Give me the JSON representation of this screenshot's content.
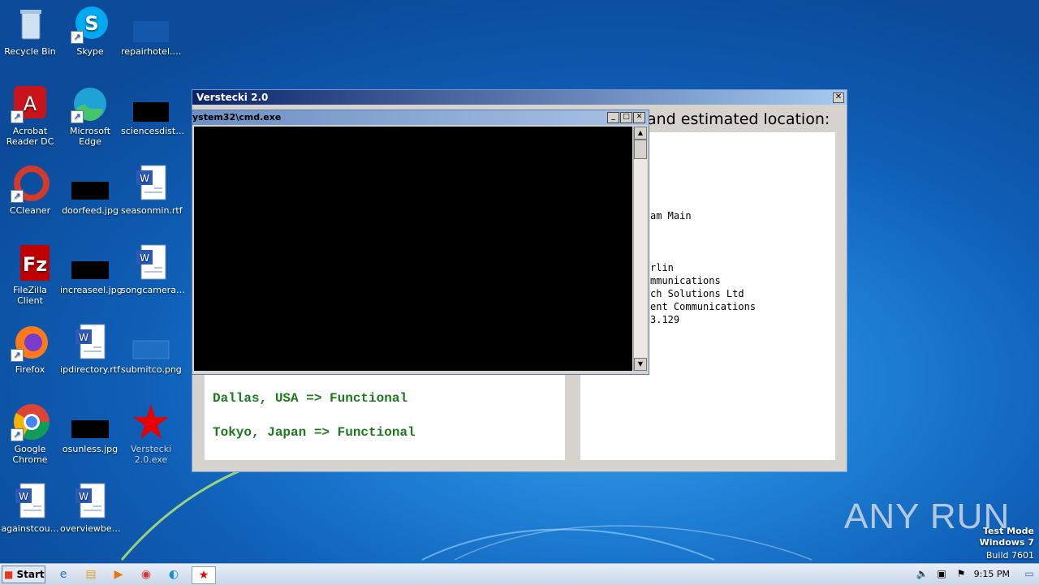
{
  "desktop_icons": [
    {
      "id": "recycle",
      "label": "Recycle Bin",
      "icon": "recycle-bin-icon"
    },
    {
      "id": "skype",
      "label": "Skype",
      "icon": "skype-icon"
    },
    {
      "id": "repairhotel",
      "label": "repairhotel.…",
      "icon": "file-icon"
    },
    {
      "id": "acrobat",
      "label": "Acrobat Reader DC",
      "icon": "acrobat-icon"
    },
    {
      "id": "edge",
      "label": "Microsoft Edge",
      "icon": "edge-icon"
    },
    {
      "id": "sciencesdist",
      "label": "sciencesdist…",
      "icon": "image-file-icon"
    },
    {
      "id": "ccleaner",
      "label": "CCleaner",
      "icon": "ccleaner-icon"
    },
    {
      "id": "doorfeed",
      "label": "doorfeed.jpg",
      "icon": "image-file-icon"
    },
    {
      "id": "seasonmin",
      "label": "seasonmin.rtf",
      "icon": "word-doc-icon"
    },
    {
      "id": "filezilla",
      "label": "FileZilla Client",
      "icon": "filezilla-icon"
    },
    {
      "id": "increaseel",
      "label": "increaseel.jpg",
      "icon": "image-file-icon"
    },
    {
      "id": "songcamera",
      "label": "songcamera…",
      "icon": "word-doc-icon"
    },
    {
      "id": "firefox",
      "label": "Firefox",
      "icon": "firefox-icon"
    },
    {
      "id": "ipdirectory",
      "label": "ipdirectory.rtf",
      "icon": "word-doc-icon"
    },
    {
      "id": "submitco",
      "label": "submitco.png",
      "icon": "image-file-icon"
    },
    {
      "id": "chrome",
      "label": "Google Chrome",
      "icon": "chrome-icon"
    },
    {
      "id": "osunless",
      "label": "osunless.jpg",
      "icon": "image-file-icon"
    },
    {
      "id": "verstecki_exe",
      "label": "Verstecki 2.0.exe",
      "icon": "red-star-icon"
    },
    {
      "id": "againstcou",
      "label": "againstcou…",
      "icon": "word-doc-icon"
    },
    {
      "id": "overviewbe",
      "label": "overviewbe…",
      "icon": "word-doc-icon"
    }
  ],
  "main_window": {
    "title": "Verstecki 2.0",
    "estimate_heading": "and estimated location:",
    "right_lines": [
      "am Main",
      "rlin",
      "mmunications",
      "ch Solutions Ltd",
      "ent Communications",
      "3.129"
    ],
    "status_lines": [
      "Dallas, USA => Functional",
      "Tokyo, Japan => Functional"
    ]
  },
  "cmd_window": {
    "title": "ystem32\\cmd.exe"
  },
  "taskbar": {
    "start_label": "Start",
    "clock": "9:15 PM"
  },
  "watermark": {
    "line1": "Test Mode",
    "line2": "Windows 7",
    "line3": "Build 7601",
    "brand": "ANY RUN"
  },
  "colors": {
    "status_green": "#1c7a1c",
    "title_blue": "#0a246a"
  }
}
